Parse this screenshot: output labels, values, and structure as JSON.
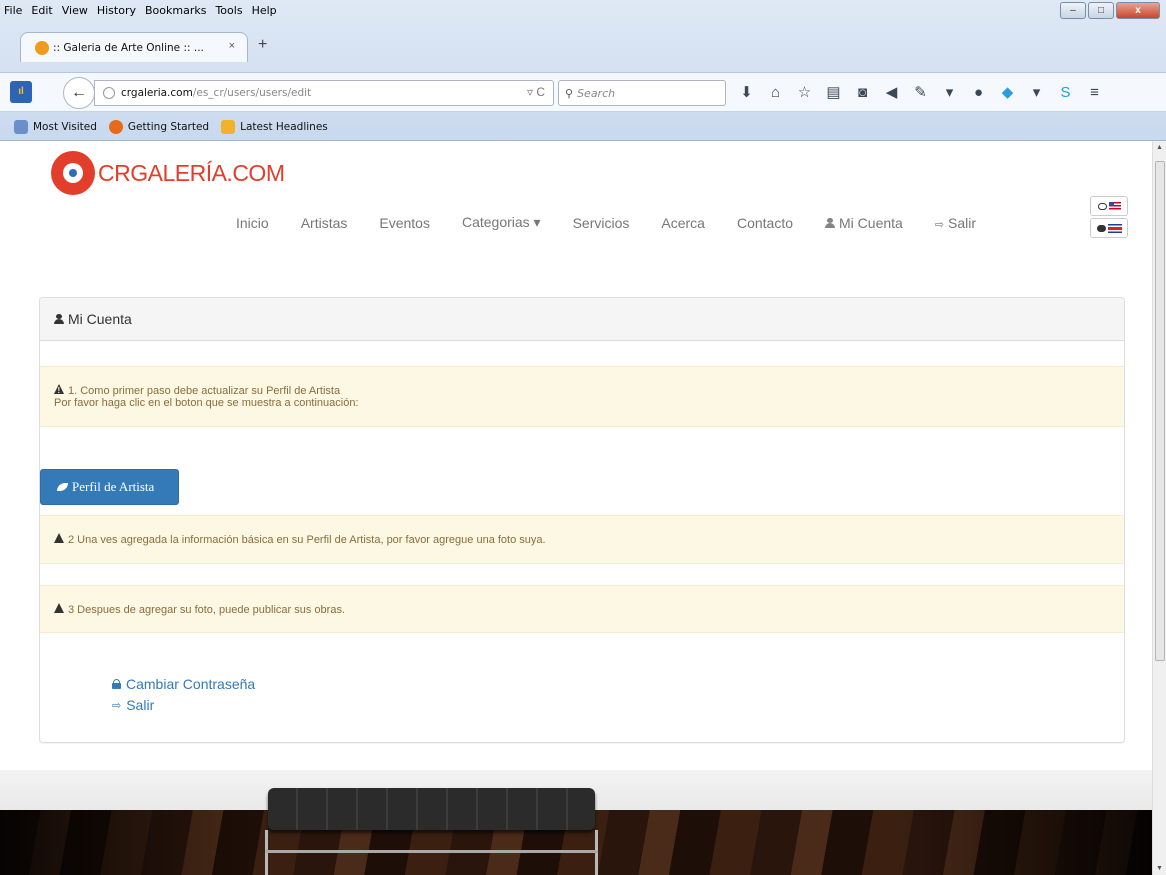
{
  "browser": {
    "menu": [
      "File",
      "Edit",
      "View",
      "History",
      "Bookmarks",
      "Tools",
      "Help"
    ],
    "window_buttons": [
      "–",
      "□",
      "x"
    ],
    "tab_title": ":: Galeria de Arte Online :: ...",
    "tab_close": "×",
    "new_tab": "+",
    "url_host": "crgaleria.com",
    "url_path": "/es_cr/users/users/edit",
    "url_reload": "▿ C",
    "search_placeholder": "Search",
    "bookmarks": [
      "Most Visited",
      "Getting Started",
      "Latest Headlines"
    ]
  },
  "site": {
    "logo_text": "CRGALERÍA.COM",
    "nav": [
      {
        "label": "Inicio"
      },
      {
        "label": "Artistas"
      },
      {
        "label": "Eventos"
      },
      {
        "label": "Categorias ▾"
      },
      {
        "label": "Servicios"
      },
      {
        "label": "Acerca"
      },
      {
        "label": "Contacto"
      },
      {
        "label": "Mi Cuenta"
      },
      {
        "label": "Salir"
      }
    ],
    "language_flags": [
      "en-us",
      "es-cr"
    ]
  },
  "panel": {
    "title": "Mi Cuenta",
    "alert1_line1": "1. Como primer paso debe actualizar su Perfil de Artista",
    "alert1_line2": "Por favor haga clic en el boton que se muestra a continuación:",
    "artist_button": "Perfil de Artista",
    "alert2": "2 Una ves agregada la información básica en su Perfil de Artista, por favor agregue una foto suya.",
    "alert3": "3 Despues de agregar su foto, puede publicar sus obras.",
    "change_password": "Cambiar Contraseña",
    "logout": "Salir"
  },
  "colors": {
    "brand_red": "#e33d2b",
    "link_blue": "#337ab7",
    "alert_bg": "#fcf8e3",
    "alert_text": "#8a6d3b"
  }
}
